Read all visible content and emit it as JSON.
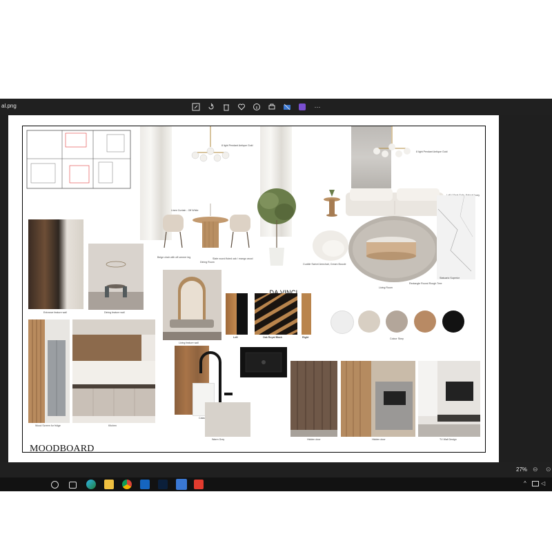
{
  "window": {
    "filename": "al.png"
  },
  "toolbar": {
    "icons": [
      "edit-icon",
      "rotate-icon",
      "delete-icon",
      "heart-icon",
      "info-icon",
      "print-icon",
      "share-icon",
      "app-icon",
      "more-icon"
    ],
    "more_label": "···"
  },
  "moodboard": {
    "title": "MOODBOARD",
    "brand": "DA VINCI",
    "brand_sub": "OAK ROYAL BLACK",
    "labels": {
      "pendant_left": "8 light Pendant Antique Gold",
      "pendant_right": "8 light Pendant Antique Gold",
      "linen_curtain": "Linen Curtain - Off White",
      "beige_chair": "Beige chair with off-veneer leg",
      "dining_room": "Dining Room",
      "slate_table": "Slate round fluted oak / mango wood",
      "entrance_wall": "Entrance feature wall",
      "dining_wall": "Dining feature wall",
      "living_wall": "Living feature wall",
      "left": "Left",
      "center": "Oak Royal Black",
      "right": "Right",
      "cuddle_chair": "Cuddle Swivel Armchair, Cream Boucle",
      "sofa": "Luff 4 Seat Sofa, Natural Ivory",
      "living_room": "Living Room",
      "coffee_table": "Rectangle Round Rough Tree",
      "statuario": "Statuario Superior",
      "colour_story": "Colour Story",
      "cement": "Cement",
      "wood_screen": "Wood Screen for fridge",
      "kitchen": "Kitchen",
      "calacatta": "Calacatta",
      "warm_grey": "Warm Grey",
      "hidden_door1": "Hidden door",
      "hidden_door2": "Hidden door",
      "tv_wall": "TV Wall Design"
    },
    "swatch_colors": [
      "#eeeeee",
      "#d8cfc3",
      "#b3a69a",
      "#b88a64",
      "#121212"
    ]
  },
  "status": {
    "zoom": "27%"
  },
  "taskbar": {
    "icons": [
      "start-circle-icon",
      "task-view-icon",
      "edge-icon",
      "explorer-icon",
      "chrome-icon",
      "outlook-icon",
      "photoshop-icon",
      "photos-icon",
      "acrobat-icon"
    ]
  },
  "colors": {
    "window_bg": "#1f1f1f",
    "accent": "#3a78d4"
  }
}
